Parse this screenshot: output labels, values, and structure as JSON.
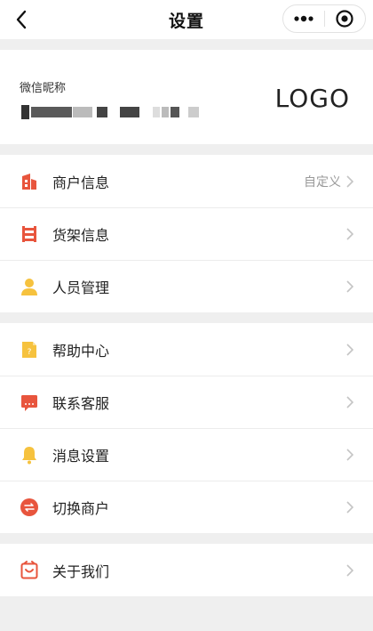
{
  "navbar": {
    "title": "设置"
  },
  "profile": {
    "nickname_label": "微信昵称",
    "logo_text": "LOGO"
  },
  "group1": [
    {
      "label": "商户信息",
      "value": "自定义",
      "icon": "shop-icon"
    },
    {
      "label": "货架信息",
      "value": "",
      "icon": "shelf-icon"
    },
    {
      "label": "人员管理",
      "value": "",
      "icon": "person-icon"
    }
  ],
  "group2": [
    {
      "label": "帮助中心",
      "value": "",
      "icon": "help-icon"
    },
    {
      "label": "联系客服",
      "value": "",
      "icon": "service-icon"
    },
    {
      "label": "消息设置",
      "value": "",
      "icon": "bell-icon"
    },
    {
      "label": "切换商户",
      "value": "",
      "icon": "switch-icon"
    }
  ],
  "group3": [
    {
      "label": "关于我们",
      "value": "",
      "icon": "about-icon"
    }
  ],
  "colors": {
    "accent_red": "#e8553d",
    "accent_yellow": "#f6c23e",
    "chevron": "#c4c4c4"
  }
}
